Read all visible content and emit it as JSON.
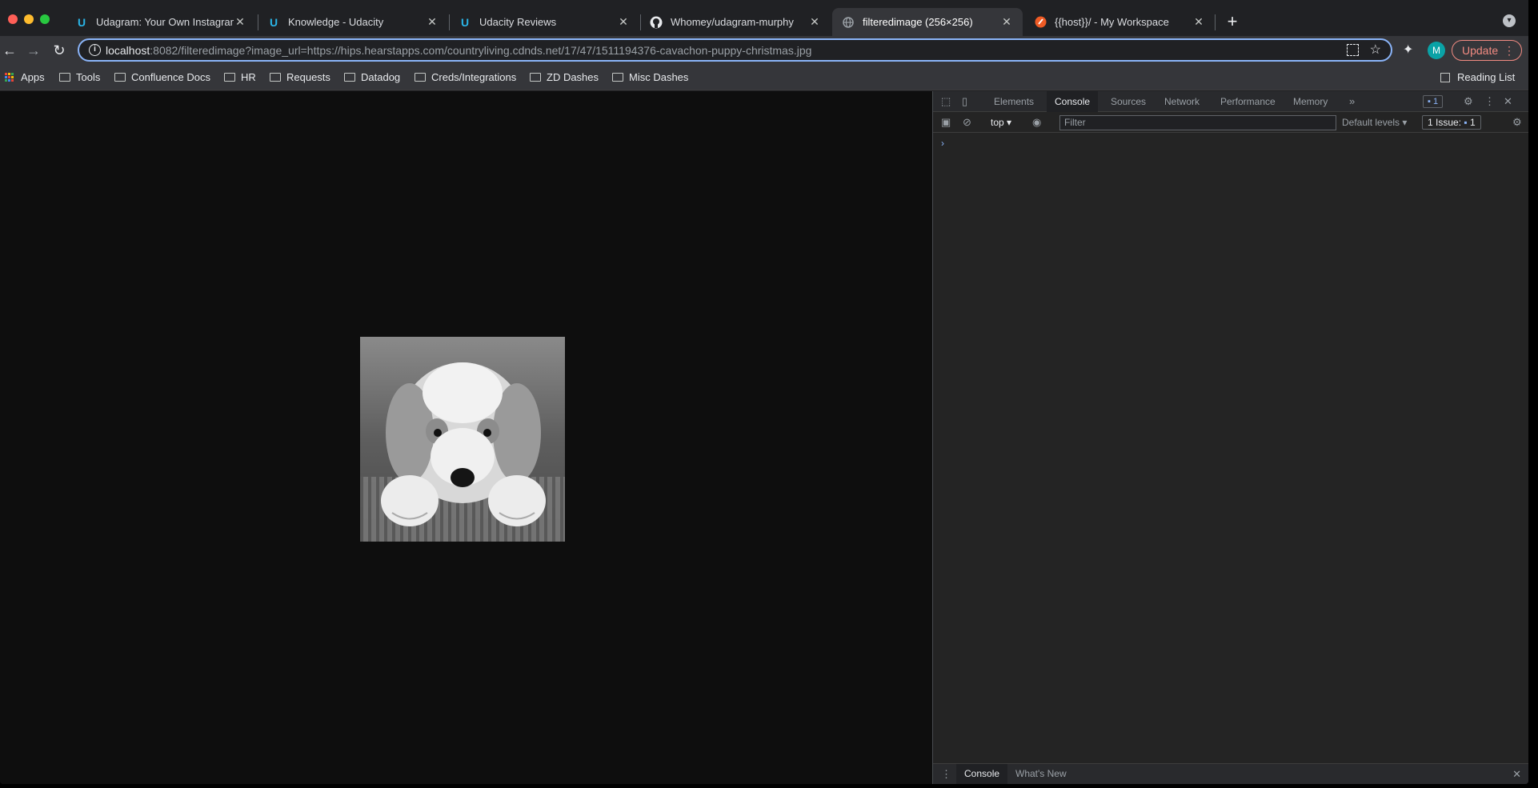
{
  "tabs": [
    {
      "title": "Udagram: Your Own Instagram",
      "favicon": "udacity-icon",
      "active": false
    },
    {
      "title": "Knowledge - Udacity",
      "favicon": "udacity-icon",
      "active": false
    },
    {
      "title": "Udacity Reviews",
      "favicon": "udacity-icon",
      "active": false
    },
    {
      "title": "Whomey/udagram-murphy",
      "favicon": "github-icon",
      "active": false
    },
    {
      "title": "filteredimage (256×256)",
      "favicon": "globe-icon",
      "active": true
    },
    {
      "title": "{{host}}/ - My Workspace",
      "favicon": "postman-icon",
      "active": false
    }
  ],
  "toolbar": {
    "url_host": "localhost",
    "url_rest": ":8082/filteredimage?image_url=https://hips.hearstapps.com/countryliving.cdnds.net/17/47/1511194376-cavachon-puppy-christmas.jpg",
    "avatar_letter": "M",
    "update_label": "Update"
  },
  "bookmarks": {
    "apps": "Apps",
    "items": [
      "Tools",
      "Confluence Docs",
      "HR",
      "Requests",
      "Datadog",
      "Creds/Integrations",
      "ZD Dashes",
      "Misc Dashes"
    ],
    "reading_list": "Reading List"
  },
  "devtools": {
    "tabs": [
      "Elements",
      "Console",
      "Sources",
      "Network",
      "Performance",
      "Memory"
    ],
    "active_tab": "Console",
    "badge_count": "1",
    "context": "top",
    "filter_placeholder": "Filter",
    "levels": "Default levels",
    "issues_label": "1 Issue:",
    "issues_count": "1",
    "prompt": "›",
    "drawer_tabs": [
      "Console",
      "What's New"
    ]
  },
  "colors": {
    "accent": "#8ab4f8",
    "update": "#f28b82",
    "page_bg": "#0e0e0e"
  }
}
